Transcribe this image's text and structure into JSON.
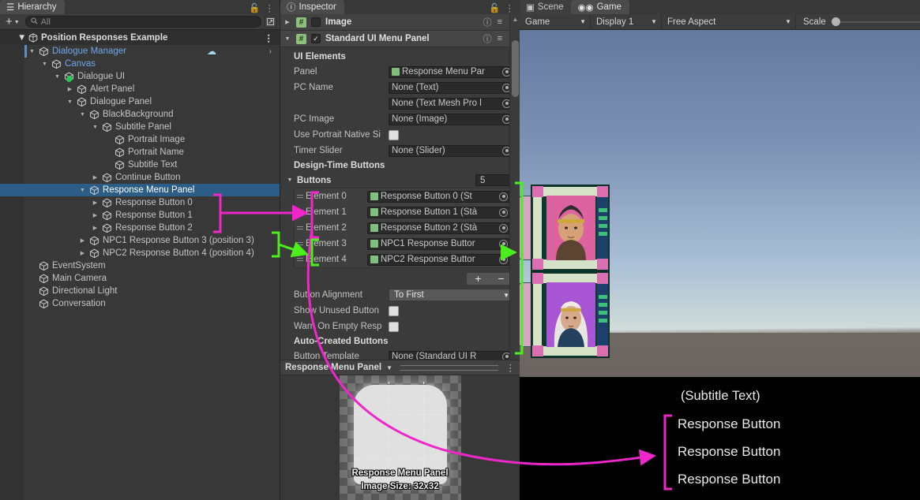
{
  "hierarchy": {
    "tab_label": "Hierarchy",
    "toolbar": {
      "add_label": "+",
      "search_placeholder": "All",
      "search_value": ""
    },
    "scene_root": "Position Responses Example",
    "items": [
      {
        "label": "Dialogue Manager",
        "depth": 1,
        "twisty": "down",
        "style": "blue",
        "selected": false
      },
      {
        "label": "Canvas",
        "depth": 2,
        "twisty": "down",
        "style": "blue",
        "selected": false
      },
      {
        "label": "Dialogue UI",
        "depth": 3,
        "twisty": "down",
        "style": "normal",
        "selected": false
      },
      {
        "label": "Alert Panel",
        "depth": 4,
        "twisty": "right",
        "style": "normal",
        "selected": false
      },
      {
        "label": "Dialogue Panel",
        "depth": 4,
        "twisty": "down",
        "style": "normal",
        "selected": false
      },
      {
        "label": "BlackBackground",
        "depth": 5,
        "twisty": "down",
        "style": "normal",
        "selected": false
      },
      {
        "label": "Subtitle Panel",
        "depth": 6,
        "twisty": "down",
        "style": "normal",
        "selected": false
      },
      {
        "label": "Portrait Image",
        "depth": 7,
        "twisty": "none",
        "style": "normal",
        "selected": false
      },
      {
        "label": "Portrait Name",
        "depth": 7,
        "twisty": "none",
        "style": "normal",
        "selected": false
      },
      {
        "label": "Subtitle Text",
        "depth": 7,
        "twisty": "none",
        "style": "normal",
        "selected": false
      },
      {
        "label": "Continue Button",
        "depth": 6,
        "twisty": "right",
        "style": "normal",
        "selected": false
      },
      {
        "label": "Response Menu Panel",
        "depth": 5,
        "twisty": "down",
        "style": "normal",
        "selected": true
      },
      {
        "label": "Response Button 0",
        "depth": 6,
        "twisty": "right",
        "style": "normal",
        "selected": false
      },
      {
        "label": "Response Button 1",
        "depth": 6,
        "twisty": "right",
        "style": "normal",
        "selected": false
      },
      {
        "label": "Response Button 2",
        "depth": 6,
        "twisty": "right",
        "style": "normal",
        "selected": false
      },
      {
        "label": "NPC1 Response Button 3 (position 3)",
        "depth": 5,
        "twisty": "right",
        "style": "normal",
        "selected": false
      },
      {
        "label": "NPC2 Response Button 4 (position 4)",
        "depth": 5,
        "twisty": "right",
        "style": "normal",
        "selected": false
      },
      {
        "label": "EventSystem",
        "depth": 1,
        "twisty": "none",
        "style": "normal",
        "selected": false
      },
      {
        "label": "Main Camera",
        "depth": 1,
        "twisty": "none",
        "style": "normal",
        "selected": false
      },
      {
        "label": "Directional Light",
        "depth": 1,
        "twisty": "none",
        "style": "normal",
        "selected": false
      },
      {
        "label": "Conversation",
        "depth": 1,
        "twisty": "none",
        "style": "normal",
        "selected": false
      }
    ]
  },
  "inspector": {
    "tab_label": "Inspector",
    "components": [
      {
        "name": "Image",
        "enabled": false,
        "expanded": false
      },
      {
        "name": "Standard UI Menu Panel",
        "enabled": true,
        "expanded": true
      }
    ],
    "sections": {
      "ui_elements_header": "UI Elements",
      "design_time_header": "Design-Time Buttons",
      "auto_created_header": "Auto-Created Buttons"
    },
    "fields": [
      {
        "label": "Panel",
        "value": "Response Menu Par",
        "kind": "object-ref",
        "has_icon": true
      },
      {
        "label": "PC Name",
        "value": "None (Text)",
        "kind": "object-ref",
        "has_icon": false
      },
      {
        "label": "",
        "value": "None (Text Mesh Pro l",
        "kind": "object-ref",
        "has_icon": false
      },
      {
        "label": "PC Image",
        "value": "None (Image)",
        "kind": "object-ref",
        "has_icon": false
      },
      {
        "label": "Use Portrait Native Si",
        "value": "",
        "kind": "checkbox",
        "checked": false
      },
      {
        "label": "Timer Slider",
        "value": "None (Slider)",
        "kind": "object-ref",
        "has_icon": false
      }
    ],
    "buttons_array": {
      "label": "Buttons",
      "size": "5",
      "elements": [
        {
          "label": "Element 0",
          "value": "Response Button 0 (St"
        },
        {
          "label": "Element 1",
          "value": "Response Button 1 (Stà"
        },
        {
          "label": "Element 2",
          "value": "Response Button 2 (Stà"
        },
        {
          "label": "Element 3",
          "value": "NPC1 Response Buttor"
        },
        {
          "label": "Element 4",
          "value": "NPC2 Response Buttor"
        }
      ],
      "add_label": "+",
      "remove_label": "−"
    },
    "post_fields": [
      {
        "label": "Button Alignment",
        "value": "To First",
        "kind": "popup"
      },
      {
        "label": "Show Unused Button",
        "value": "",
        "kind": "checkbox",
        "checked": false
      },
      {
        "label": "Warn On Empty Resp",
        "value": "",
        "kind": "checkbox",
        "checked": false
      }
    ],
    "auto_created_field": {
      "label": "Button Template",
      "value": "None (Standard UI R"
    },
    "preview": {
      "title": "Response Menu Panel",
      "caption_name": "Response Menu Panel",
      "caption_size": "Image Size: 32x32"
    }
  },
  "game": {
    "tabs": [
      {
        "label": "Scene",
        "active": false,
        "icon": "grid-icon"
      },
      {
        "label": "Game",
        "active": true,
        "icon": "gamepad-icon"
      }
    ],
    "toolbar": {
      "target": "Game",
      "display": "Display 1",
      "aspect": "Free Aspect",
      "scale_label": "Scale",
      "scale_value": 0
    },
    "content": {
      "subtitle_text": "(Subtitle Text)",
      "responses": [
        "Response Button",
        "Response Button",
        "Response Button"
      ],
      "portraits": [
        {
          "name": "npc1-portrait"
        },
        {
          "name": "npc2-portrait"
        }
      ]
    }
  },
  "annotations": {
    "magenta_color": "#ef27c8",
    "green_color": "#4bf01b",
    "magenta_note": "links Response Button 0-2 in hierarchy to Elements 0-2 and to Game view responses",
    "green_note": "links NPC1/NPC2 Response Buttons to Elements 3-4 and to Game view portraits"
  }
}
